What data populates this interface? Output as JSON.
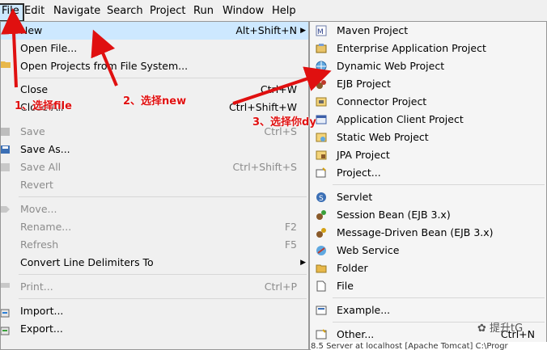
{
  "menubar": {
    "items": [
      {
        "label": "File"
      },
      {
        "label": "Edit"
      },
      {
        "label": "Navigate"
      },
      {
        "label": "Search"
      },
      {
        "label": "Project"
      },
      {
        "label": "Run"
      },
      {
        "label": "Window"
      },
      {
        "label": "Help"
      }
    ]
  },
  "file_menu": {
    "new": {
      "label": "New",
      "accel": "Alt+Shift+N"
    },
    "open_file": {
      "label": "Open File..."
    },
    "open_projects": {
      "label": "Open Projects from File System..."
    },
    "close": {
      "label": "Close",
      "accel": "Ctrl+W"
    },
    "close_all": {
      "label": "Close All",
      "accel": "Ctrl+Shift+W"
    },
    "save": {
      "label": "Save",
      "accel": "Ctrl+S"
    },
    "save_as": {
      "label": "Save As..."
    },
    "save_all": {
      "label": "Save All",
      "accel": "Ctrl+Shift+S"
    },
    "revert": {
      "label": "Revert"
    },
    "move": {
      "label": "Move..."
    },
    "rename": {
      "label": "Rename...",
      "accel": "F2"
    },
    "refresh": {
      "label": "Refresh",
      "accel": "F5"
    },
    "convert": {
      "label": "Convert Line Delimiters To"
    },
    "print": {
      "label": "Print...",
      "accel": "Ctrl+P"
    },
    "import": {
      "label": "Import..."
    },
    "export": {
      "label": "Export..."
    }
  },
  "new_menu": {
    "items": [
      {
        "label": "Maven Project",
        "icon": "maven-project-icon"
      },
      {
        "label": "Enterprise Application Project",
        "icon": "enterprise-app-icon"
      },
      {
        "label": "Dynamic Web Project",
        "icon": "dynamic-web-project-icon"
      },
      {
        "label": "EJB Project",
        "icon": "ejb-project-icon"
      },
      {
        "label": "Connector Project",
        "icon": "connector-project-icon"
      },
      {
        "label": "Application Client Project",
        "icon": "app-client-project-icon"
      },
      {
        "label": "Static Web Project",
        "icon": "static-web-project-icon"
      },
      {
        "label": "JPA Project",
        "icon": "jpa-project-icon"
      },
      {
        "label": "Project...",
        "icon": "project-icon"
      },
      {
        "label": "Servlet",
        "icon": "servlet-icon"
      },
      {
        "label": "Session Bean (EJB 3.x)",
        "icon": "session-bean-icon"
      },
      {
        "label": "Message-Driven Bean (EJB 3.x)",
        "icon": "message-bean-icon"
      },
      {
        "label": "Web Service",
        "icon": "web-service-icon"
      },
      {
        "label": "Folder",
        "icon": "folder-icon"
      },
      {
        "label": "File",
        "icon": "file-icon"
      },
      {
        "label": "Example...",
        "icon": "example-icon"
      },
      {
        "label": "Other...",
        "icon": "other-icon",
        "accel": "Ctrl+N"
      }
    ]
  },
  "annotations": {
    "step1": "1、选择file",
    "step2": "2、选择new",
    "step3": "3、选择你dy"
  },
  "watermark": "提升tG",
  "background_text": "8.5 Server at localhost [Apache Tomcat] C:\\Progr",
  "colors": {
    "annotation": "#e01010",
    "highlight": "#cde8ff",
    "menu_bg": "#f0f0f0"
  }
}
